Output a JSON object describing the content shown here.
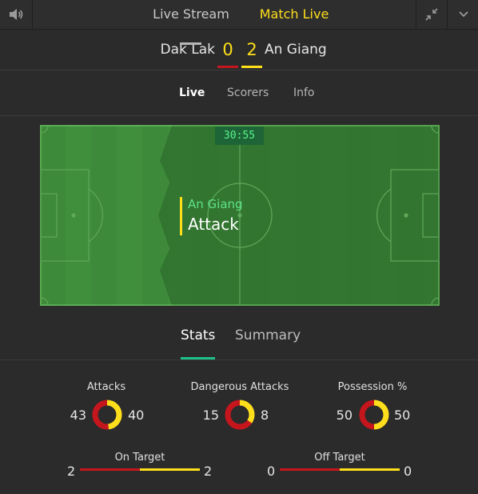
{
  "topbar": {
    "live_stream": "Live Stream",
    "match_live": "Match Live"
  },
  "match": {
    "home_team": "Dak Lak",
    "away_team": "An Giang",
    "home_score": "0",
    "away_score": "2"
  },
  "subtabs": [
    "Live",
    "Scorers",
    "Info"
  ],
  "pitch": {
    "clock": "30:55",
    "event_team": "An Giang",
    "event_type": "Attack"
  },
  "stats_tabs": [
    "Stats",
    "Summary"
  ],
  "stats": [
    {
      "label": "Attacks",
      "home": "43",
      "away": "40"
    },
    {
      "label": "Dangerous Attacks",
      "home": "15",
      "away": "8"
    },
    {
      "label": "Possession %",
      "home": "50",
      "away": "50"
    }
  ],
  "line_stats": [
    {
      "label": "On Target",
      "home": "2",
      "away": "2"
    },
    {
      "label": "Off Target",
      "home": "0",
      "away": "0"
    }
  ],
  "colors": {
    "home": "#c5161d",
    "away": "#ffdf1b",
    "accent_green": "#1fc089",
    "pitch_light": "#3f8f3c",
    "pitch_dark": "#347a32"
  }
}
